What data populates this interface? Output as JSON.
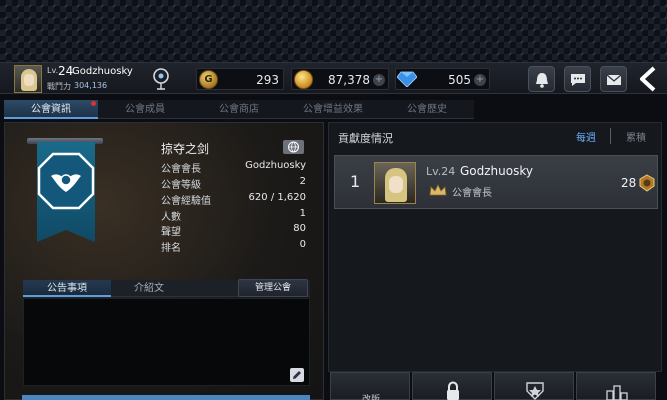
{
  "player": {
    "level_prefix": "Lv.",
    "level": "24",
    "name": "Godzhuosky",
    "power_label": "戰鬥力",
    "power_value": "304,136"
  },
  "currency": {
    "gold": "293",
    "coins": "87,378",
    "gems": "505",
    "gold_symbol": "G"
  },
  "tabs": [
    {
      "label": "公會資訊",
      "active": true
    },
    {
      "label": "公會成員"
    },
    {
      "label": "公會商店"
    },
    {
      "label": "公會增益效果"
    },
    {
      "label": "公會歷史"
    }
  ],
  "guild": {
    "name": "掠夺之剑",
    "fields": [
      {
        "label": "公會會長",
        "value": "Godzhuosky"
      },
      {
        "label": "公會等級",
        "value": "2"
      },
      {
        "label": "公會經驗值",
        "value": "620 / 1,620"
      },
      {
        "label": "人數",
        "value": "1"
      },
      {
        "label": "聲望",
        "value": "80"
      },
      {
        "label": "排名",
        "value": "0"
      }
    ]
  },
  "notice": {
    "tabs": [
      "公告事項",
      "介紹文"
    ],
    "manage_label": "管理公會",
    "text": ""
  },
  "contribution": {
    "title": "貢獻度情況",
    "filters": [
      "每週",
      "累積"
    ],
    "rows": [
      {
        "rank": "1",
        "level": "Lv.24",
        "name": "Godzhuosky",
        "role": "公會會長",
        "score": "28"
      }
    ]
  },
  "bottom_buttons": [
    {
      "label": "改版"
    }
  ],
  "colors": {
    "accent": "#5aa0e0",
    "tab_active": "#2d4a66",
    "banner": "#1a6a8a"
  },
  "icons": [
    "compass-icon",
    "gold-coin-icon",
    "coins-icon",
    "gem-icon",
    "bell-icon",
    "chat-icon",
    "mail-icon",
    "back-arrow-icon",
    "globe-icon",
    "edit-icon",
    "lock-icon",
    "emblem-icon",
    "ranking-icon"
  ]
}
